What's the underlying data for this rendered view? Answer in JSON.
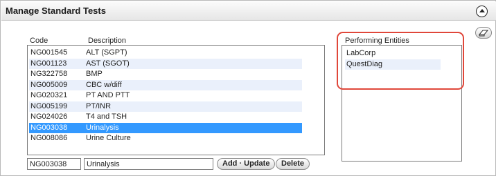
{
  "panel": {
    "title": "Manage Standard Tests"
  },
  "tests": {
    "code_header": "Code",
    "description_header": "Description",
    "rows": [
      {
        "code": "NG001545",
        "description": "ALT (SGPT)"
      },
      {
        "code": "NG001123",
        "description": "AST (SGOT)"
      },
      {
        "code": "NG322758",
        "description": "BMP"
      },
      {
        "code": "NG005009",
        "description": "CBC w/diff"
      },
      {
        "code": "NG020321",
        "description": "PT AND PTT"
      },
      {
        "code": "NG005199",
        "description": "PT/INR"
      },
      {
        "code": "NG024026",
        "description": "T4 and TSH"
      },
      {
        "code": "NG003038",
        "description": "Urinalysis"
      },
      {
        "code": "NG008086",
        "description": "Urine Culture"
      }
    ],
    "selected_index": 7
  },
  "entities": {
    "header": "Performing Entities",
    "rows": [
      "LabCorp",
      "QuestDiag"
    ]
  },
  "editor": {
    "code_value": "NG003038",
    "description_value": "Urinalysis",
    "add_update_label": "Add · Update",
    "delete_label": "Delete"
  },
  "colors": {
    "selection": "#3399ff",
    "alt_row": "#eaf0fb",
    "callout": "#e0473a"
  },
  "icons": {
    "collapse": "collapse-up-icon",
    "clear": "eraser-icon"
  }
}
